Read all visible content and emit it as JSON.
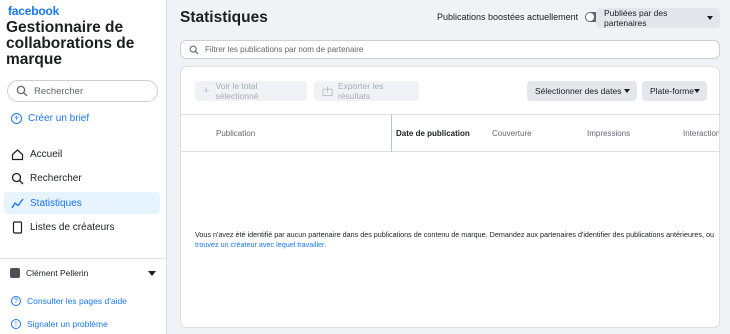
{
  "sidebar": {
    "brand": "facebook",
    "title": "Gestionnaire de collaborations de marque",
    "search_placeholder": "Rechercher",
    "create_brief": "Créer un brief",
    "nav": [
      {
        "label": "Accueil",
        "icon": "home-icon"
      },
      {
        "label": "Rechercher",
        "icon": "search-icon"
      },
      {
        "label": "Statistiques",
        "icon": "insights-icon",
        "active": true
      },
      {
        "label": "Listes de créateurs",
        "icon": "list-icon"
      }
    ],
    "user_name": "Clément Pellerin",
    "help_label": "Consulter les pages d'aide",
    "report_label": "Signaler un problème"
  },
  "header": {
    "title": "Statistiques",
    "boosted_label": "Publications boostées actuellement",
    "boosted_on": false,
    "partners_dropdown": "Publiées par des partenaires"
  },
  "filter": {
    "placeholder": "Filtrer les publications par nom de partenaire"
  },
  "toolbar": {
    "view_total": "Voir le total sélectionné",
    "export": "Exporter les résultats",
    "select_dates": "Sélectionner des dates",
    "platform": "Plate-forme"
  },
  "table": {
    "columns": [
      "Publication",
      "Date de publication",
      "Couverture",
      "Impressions",
      "Interactions"
    ]
  },
  "empty_state": {
    "message": "Vous n'avez été identifié par aucun partenaire dans des publications de contenu de marque. Demandez aux partenaires d'identifier des publications antérieures, ou",
    "link": "trouvez un créateur avec lequel travailler."
  },
  "colors": {
    "accent": "#1877f2",
    "background": "#f0f2f5",
    "active_nav_bg": "#e7f3ff"
  }
}
